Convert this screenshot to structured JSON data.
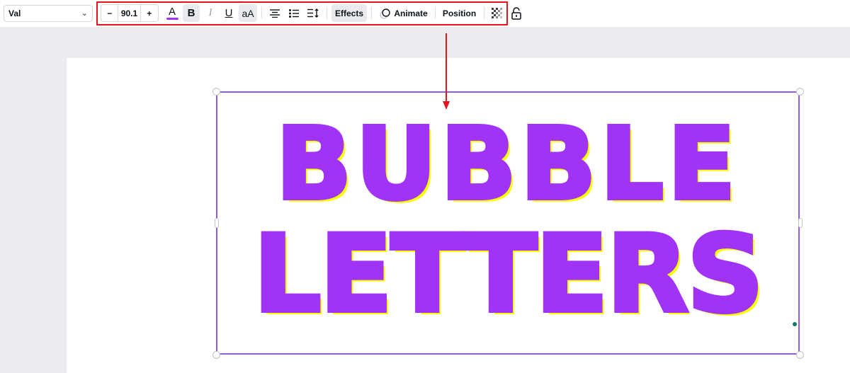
{
  "toolbar": {
    "font_name": "Val",
    "font_size": {
      "decrease_label": "−",
      "value": "90.1",
      "increase_label": "+"
    },
    "text_color_label": "A",
    "text_color": "#a033f6",
    "bold_label": "B",
    "italic_label": "I",
    "underline_label": "U",
    "case_label": "aA",
    "effects_label": "Effects",
    "animate_label": "Animate",
    "position_label": "Position",
    "icons": {
      "align": "align-center-icon",
      "list": "list-icon",
      "spacing": "line-spacing-icon",
      "animate": "animate-icon",
      "transparency": "transparency-icon",
      "lock": "lock-icon"
    }
  },
  "annotation": {
    "highlight_color": "#e8141c"
  },
  "canvas": {
    "text_lines": [
      "BUBBLE",
      "LETTERS"
    ],
    "fill_color": "#a033f6",
    "shadow_color": "#f8ff00",
    "selection_color": "#8b5cf6"
  }
}
